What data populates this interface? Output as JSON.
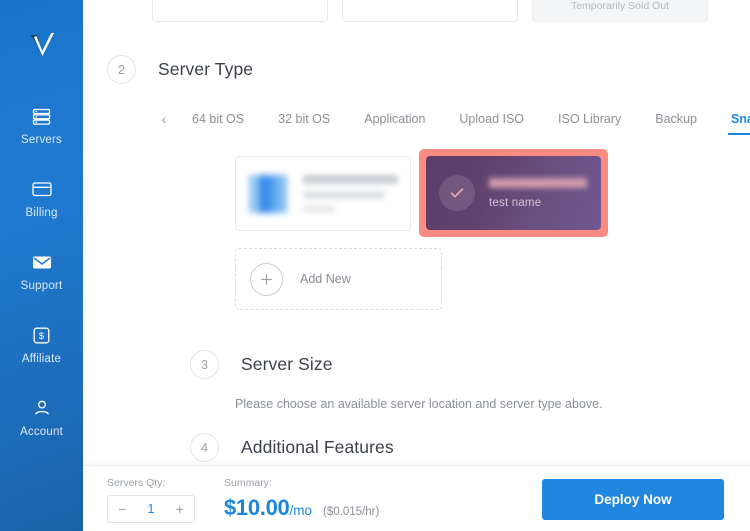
{
  "sidebar": {
    "logo_name": "vultr-v-checkmark-logo",
    "items": [
      {
        "label": "Servers",
        "icon": "servers-icon"
      },
      {
        "label": "Billing",
        "icon": "credit-card-icon"
      },
      {
        "label": "Support",
        "icon": "envelope-icon"
      },
      {
        "label": "Affiliate",
        "icon": "dollar-badge-icon"
      },
      {
        "label": "Account",
        "icon": "person-icon"
      }
    ]
  },
  "top_partial_cards": {
    "sold_out_label": "Temporarily Sold Out"
  },
  "step2": {
    "number": "2",
    "title": "Server Type",
    "tabs": [
      {
        "label": "64 bit OS",
        "active": false
      },
      {
        "label": "32 bit OS",
        "active": false
      },
      {
        "label": "Application",
        "active": false
      },
      {
        "label": "Upload ISO",
        "active": false
      },
      {
        "label": "ISO Library",
        "active": false
      },
      {
        "label": "Backup",
        "active": false
      },
      {
        "label": "Snapshot",
        "active": true
      }
    ],
    "prev_arrow": "‹",
    "next_arrow": "›",
    "cards": {
      "os_card": {
        "name": "snapshot-card-blurred",
        "label": ""
      },
      "snapshot_card": {
        "name": "test name",
        "selected": true,
        "highlight_color": "#fb8b82",
        "check_icon": "check-icon"
      },
      "add_new": {
        "label": "Add New",
        "icon": "plus-icon"
      }
    }
  },
  "step3": {
    "number": "3",
    "title": "Server Size",
    "note": "Please choose an available server location and server type above."
  },
  "step4": {
    "number": "4",
    "title": "Additional Features"
  },
  "bottom_bar": {
    "qty_label": "Servers Qty:",
    "qty_value": "1",
    "qty_minus": "−",
    "qty_plus": "+",
    "summary_label": "Summary:",
    "price_main": "$10.00",
    "price_unit": "/mo",
    "price_hourly": "($0.015/hr)",
    "deploy_label": "Deploy Now"
  },
  "colors": {
    "brand_blue": "#2086e0",
    "sidebar_blue": "#1f7ad2",
    "highlight_coral": "#fb8b82",
    "snapshot_purple": "#60406c",
    "text_dark": "#3c4149",
    "text_muted": "#8b9096"
  }
}
